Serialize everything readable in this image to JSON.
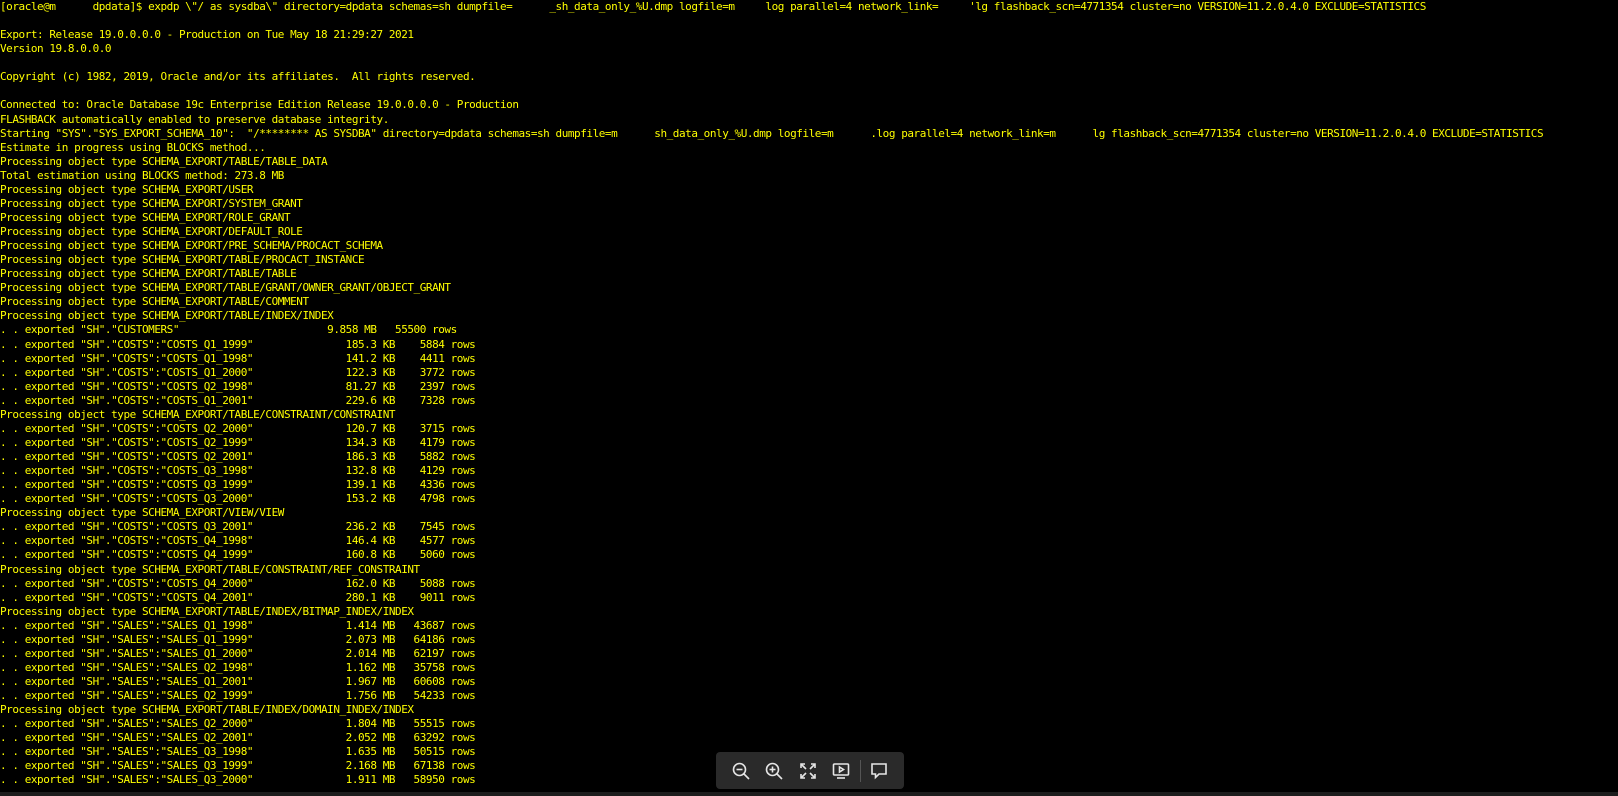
{
  "terminal": {
    "lines": [
      "[oracle@m      dpdata]$ expdp \\\"/ as sysdba\\\" directory=dpdata schemas=sh dumpfile=      _sh_data_only_%U.dmp logfile=m     log parallel=4 network_link=     'lg flashback_scn=4771354 cluster=no VERSION=11.2.0.4.0 EXCLUDE=STATISTICS",
      "",
      "Export: Release 19.0.0.0.0 - Production on Tue May 18 21:29:27 2021",
      "Version 19.8.0.0.0",
      "",
      "Copyright (c) 1982, 2019, Oracle and/or its affiliates.  All rights reserved.",
      "",
      "Connected to: Oracle Database 19c Enterprise Edition Release 19.0.0.0.0 - Production",
      "FLASHBACK automatically enabled to preserve database integrity.",
      "Starting \"SYS\".\"SYS_EXPORT_SCHEMA_10\":  \"/******** AS SYSDBA\" directory=dpdata schemas=sh dumpfile=m      sh_data_only_%U.dmp logfile=m      .log parallel=4 network_link=m      lg flashback_scn=4771354 cluster=no VERSION=11.2.0.4.0 EXCLUDE=STATISTICS",
      "Estimate in progress using BLOCKS method...",
      "Processing object type SCHEMA_EXPORT/TABLE/TABLE_DATA",
      "Total estimation using BLOCKS method: 273.8 MB",
      "Processing object type SCHEMA_EXPORT/USER",
      "Processing object type SCHEMA_EXPORT/SYSTEM_GRANT",
      "Processing object type SCHEMA_EXPORT/ROLE_GRANT",
      "Processing object type SCHEMA_EXPORT/DEFAULT_ROLE",
      "Processing object type SCHEMA_EXPORT/PRE_SCHEMA/PROCACT_SCHEMA",
      "Processing object type SCHEMA_EXPORT/TABLE/PROCACT_INSTANCE",
      "Processing object type SCHEMA_EXPORT/TABLE/TABLE",
      "Processing object type SCHEMA_EXPORT/TABLE/GRANT/OWNER_GRANT/OBJECT_GRANT",
      "Processing object type SCHEMA_EXPORT/TABLE/COMMENT",
      "Processing object type SCHEMA_EXPORT/TABLE/INDEX/INDEX",
      ". . exported \"SH\".\"CUSTOMERS\"                        9.858 MB   55500 rows",
      ". . exported \"SH\".\"COSTS\":\"COSTS_Q1_1999\"               185.3 KB    5884 rows",
      ". . exported \"SH\".\"COSTS\":\"COSTS_Q1_1998\"               141.2 KB    4411 rows",
      ". . exported \"SH\".\"COSTS\":\"COSTS_Q1_2000\"               122.3 KB    3772 rows",
      ". . exported \"SH\".\"COSTS\":\"COSTS_Q2_1998\"               81.27 KB    2397 rows",
      ". . exported \"SH\".\"COSTS\":\"COSTS_Q1_2001\"               229.6 KB    7328 rows",
      "Processing object type SCHEMA_EXPORT/TABLE/CONSTRAINT/CONSTRAINT",
      ". . exported \"SH\".\"COSTS\":\"COSTS_Q2_2000\"               120.7 KB    3715 rows",
      ". . exported \"SH\".\"COSTS\":\"COSTS_Q2_1999\"               134.3 KB    4179 rows",
      ". . exported \"SH\".\"COSTS\":\"COSTS_Q2_2001\"               186.3 KB    5882 rows",
      ". . exported \"SH\".\"COSTS\":\"COSTS_Q3_1998\"               132.8 KB    4129 rows",
      ". . exported \"SH\".\"COSTS\":\"COSTS_Q3_1999\"               139.1 KB    4336 rows",
      ". . exported \"SH\".\"COSTS\":\"COSTS_Q3_2000\"               153.2 KB    4798 rows",
      "Processing object type SCHEMA_EXPORT/VIEW/VIEW",
      ". . exported \"SH\".\"COSTS\":\"COSTS_Q3_2001\"               236.2 KB    7545 rows",
      ". . exported \"SH\".\"COSTS\":\"COSTS_Q4_1998\"               146.4 KB    4577 rows",
      ". . exported \"SH\".\"COSTS\":\"COSTS_Q4_1999\"               160.8 KB    5060 rows",
      "Processing object type SCHEMA_EXPORT/TABLE/CONSTRAINT/REF_CONSTRAINT",
      ". . exported \"SH\".\"COSTS\":\"COSTS_Q4_2000\"               162.0 KB    5088 rows",
      ". . exported \"SH\".\"COSTS\":\"COSTS_Q4_2001\"               280.1 KB    9011 rows",
      "Processing object type SCHEMA_EXPORT/TABLE/INDEX/BITMAP_INDEX/INDEX",
      ". . exported \"SH\".\"SALES\":\"SALES_Q1_1998\"               1.414 MB   43687 rows",
      ". . exported \"SH\".\"SALES\":\"SALES_Q1_1999\"               2.073 MB   64186 rows",
      ". . exported \"SH\".\"SALES\":\"SALES_Q1_2000\"               2.014 MB   62197 rows",
      ". . exported \"SH\".\"SALES\":\"SALES_Q2_1998\"               1.162 MB   35758 rows",
      ". . exported \"SH\".\"SALES\":\"SALES_Q1_2001\"               1.967 MB   60608 rows",
      ". . exported \"SH\".\"SALES\":\"SALES_Q2_1999\"               1.756 MB   54233 rows",
      "Processing object type SCHEMA_EXPORT/TABLE/INDEX/DOMAIN_INDEX/INDEX",
      ". . exported \"SH\".\"SALES\":\"SALES_Q2_2000\"               1.804 MB   55515 rows",
      ". . exported \"SH\".\"SALES\":\"SALES_Q2_2001\"               2.052 MB   63292 rows",
      ". . exported \"SH\".\"SALES\":\"SALES_Q3_1998\"               1.635 MB   50515 rows",
      ". . exported \"SH\".\"SALES\":\"SALES_Q3_1999\"               2.168 MB   67138 rows",
      ". . exported \"SH\".\"SALES\":\"SALES_Q3_2000\"               1.911 MB   58950 rows"
    ],
    "text_color": "#ffff00",
    "background_color": "#000000"
  },
  "toolbar": {
    "buttons": [
      {
        "name": "zoom-out-button",
        "icon": "zoom-out-icon"
      },
      {
        "name": "zoom-in-button",
        "icon": "zoom-in-icon"
      },
      {
        "name": "fullscreen-button",
        "icon": "fullscreen-icon"
      },
      {
        "name": "slideshow-button",
        "icon": "slideshow-icon"
      },
      {
        "name": "comment-button",
        "icon": "comment-icon"
      }
    ]
  }
}
